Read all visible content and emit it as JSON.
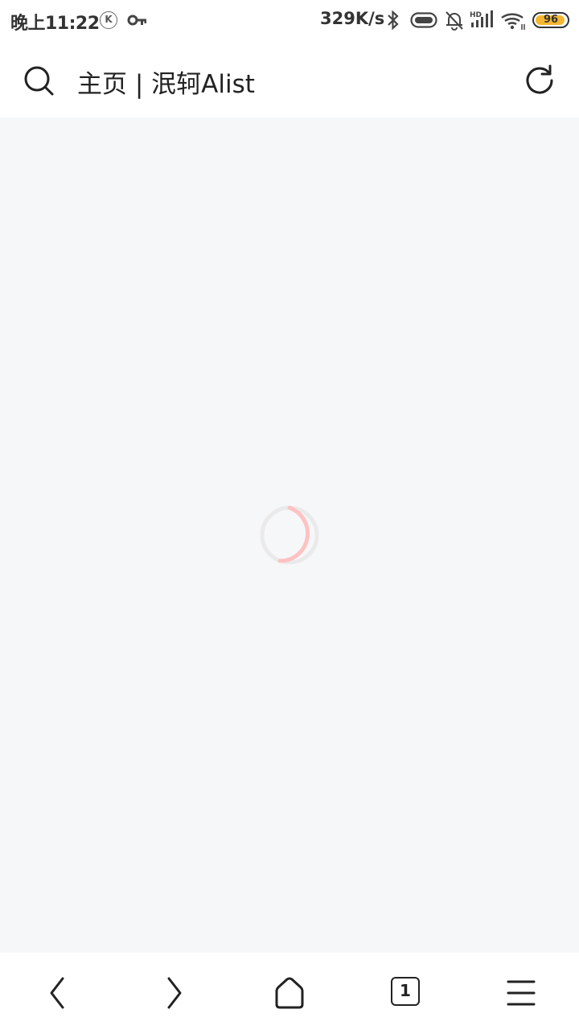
{
  "status_bar": {
    "time": "晚上11:22",
    "k_badge": "K",
    "net_speed": "329K/s",
    "hd_label": "HD",
    "battery_level": "96",
    "battery_fraction": 0.96,
    "battery_color": "#f5b731",
    "icons": [
      "k-icon",
      "vpn-key-icon",
      "bluetooth-icon",
      "vibrate-icon",
      "bell-muted-icon",
      "signal-icon",
      "wifi-icon",
      "battery-icon"
    ]
  },
  "top_nav": {
    "title": "主页 | 泯轲Alist",
    "search_icon": "search-icon",
    "refresh_icon": "refresh-icon"
  },
  "content": {
    "state": "loading",
    "spinner_color": "#ffc2c2",
    "spinner_track_color": "#eaeaea"
  },
  "bottom_bar": {
    "tab_count": "1",
    "icons": [
      "back-icon",
      "forward-icon",
      "home-icon",
      "tabs-icon",
      "menu-icon"
    ]
  }
}
